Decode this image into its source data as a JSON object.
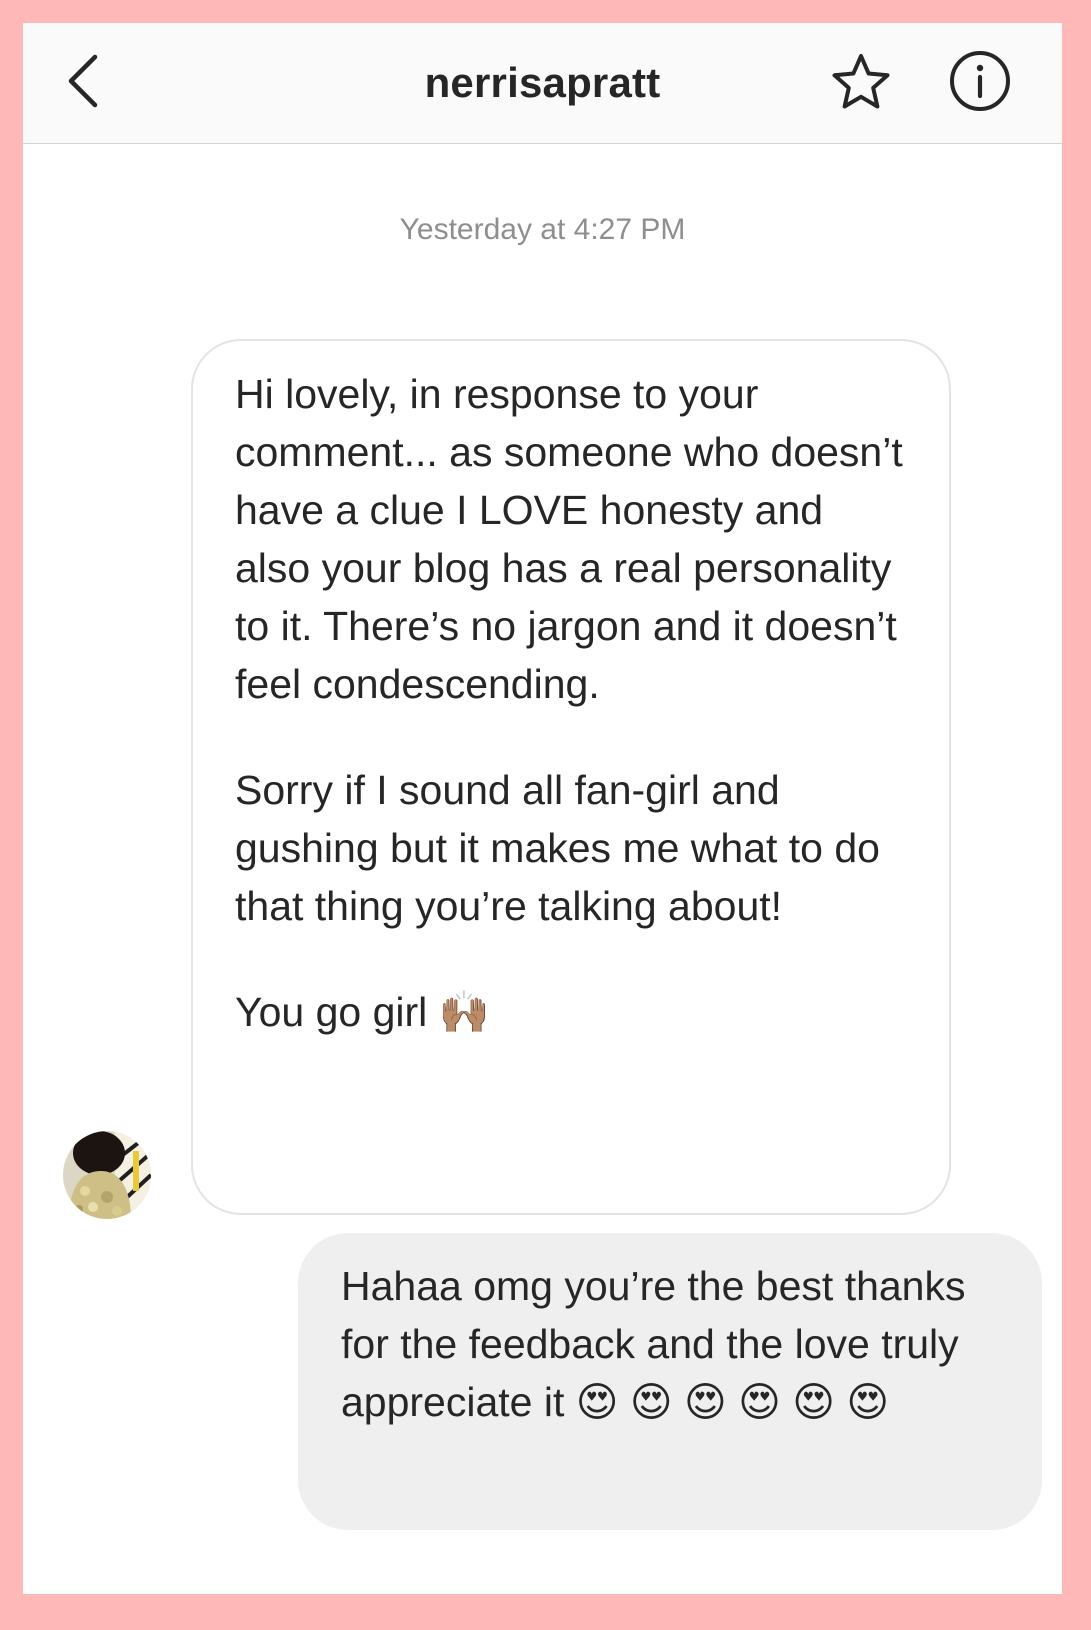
{
  "header": {
    "title": "nerrisapratt",
    "back_icon": "chevron-left-icon",
    "star_icon": "star-icon",
    "info_icon": "info-icon"
  },
  "conversation": {
    "timestamp": "Yesterday at 4:27 PM",
    "incoming": {
      "paragraphs": [
        "Hi lovely, in response to your comment... as someone who doesn’t have a clue I LOVE honesty and also your blog has a real personality to it. There’s no jargon and it doesn’t feel condescending.",
        "Sorry if I sound all fan-girl and gushing but it makes me what to do that thing you’re talking about!",
        "You go girl 🙌🏽"
      ]
    },
    "outgoing": {
      "text": "Hahaa omg you’re the best thanks for the feedback and the love truly appreciate it 😍 😍 😍 😍 😍 😍"
    }
  },
  "colors": {
    "frame_background": "#ffb8b8",
    "header_background": "#fafafa",
    "incoming_bubble_border": "#e3e3e3",
    "outgoing_bubble_background": "#efefef",
    "timestamp_text": "#8e8e8e",
    "primary_text": "#262626"
  }
}
